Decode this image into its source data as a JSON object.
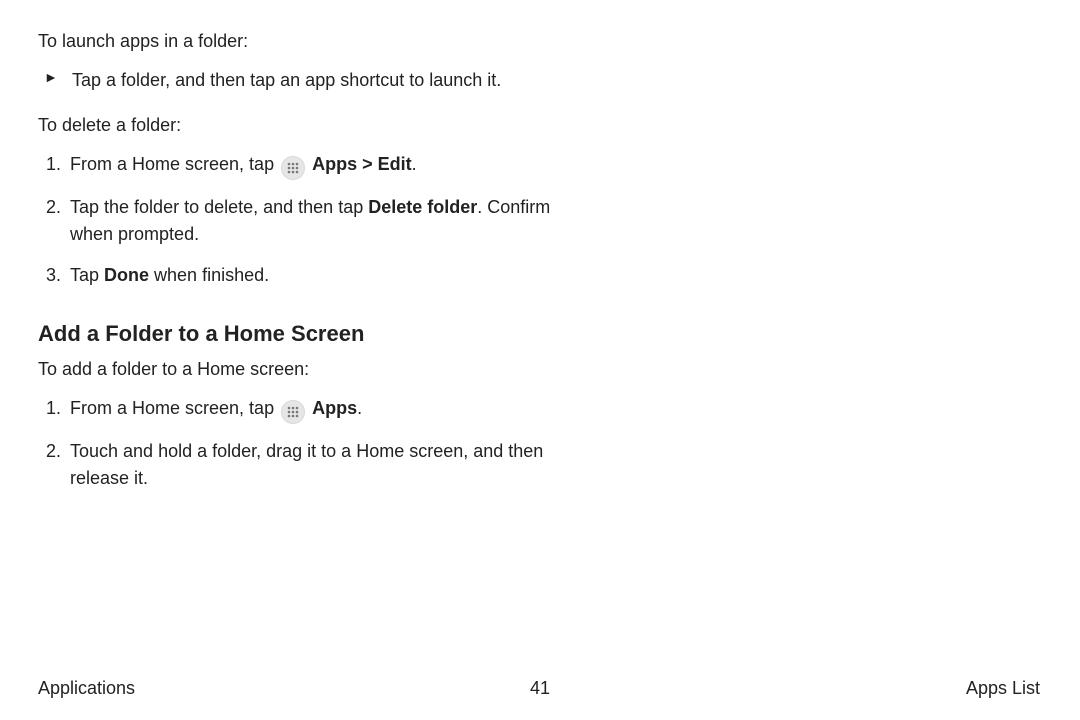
{
  "sections": {
    "launch": {
      "intro": "To launch apps in a folder:",
      "bullet": "Tap a folder, and then tap an app shortcut to launch it."
    },
    "delete": {
      "intro": "To delete a folder:",
      "step1_pre": "From a Home screen, tap ",
      "step1_apps": "Apps",
      "step1_sep": " > ",
      "step1_edit": "Edit",
      "step1_post": ".",
      "step2_pre": "Tap the folder to delete, and then tap ",
      "step2_bold": "Delete folder",
      "step2_post": ". Confirm when prompted.",
      "step3_pre": "Tap ",
      "step3_bold": "Done",
      "step3_post": " when finished."
    },
    "add": {
      "heading": "Add a Folder to a Home Screen",
      "intro": "To add a folder to a Home screen:",
      "step1_pre": "From a Home screen, tap ",
      "step1_apps": "Apps",
      "step1_post": ".",
      "step2": "Touch and hold a folder, drag it to a Home screen, and then release it."
    }
  },
  "footer": {
    "left": "Applications",
    "center": "41",
    "right": "Apps List"
  }
}
